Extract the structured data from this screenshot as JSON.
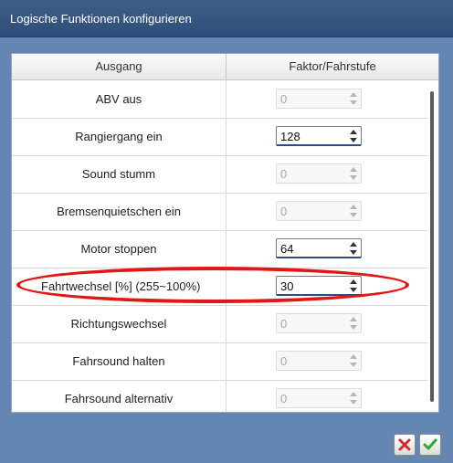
{
  "window": {
    "title": "Logische Funktionen konfigurieren"
  },
  "table": {
    "columns": [
      "Ausgang",
      "Faktor/Fahrstufe"
    ],
    "rows": [
      {
        "label": "ABV aus",
        "value": "0",
        "enabled": false
      },
      {
        "label": "Rangiergang ein",
        "value": "128",
        "enabled": true
      },
      {
        "label": "Sound stumm",
        "value": "0",
        "enabled": false
      },
      {
        "label": "Bremsenquietschen ein",
        "value": "0",
        "enabled": false
      },
      {
        "label": "Motor stoppen",
        "value": "64",
        "enabled": true
      },
      {
        "label": "Fahrtwechsel [%] (255~100%)",
        "value": "30",
        "enabled": true,
        "highlighted": true
      },
      {
        "label": "Richtungswechsel",
        "value": "0",
        "enabled": false
      },
      {
        "label": "Fahrsound halten",
        "value": "0",
        "enabled": false
      },
      {
        "label": "Fahrsound alternativ",
        "value": "0",
        "enabled": false
      }
    ]
  },
  "buttons": {
    "cancel_icon": "close-icon",
    "ok_icon": "check-icon"
  },
  "colors": {
    "title_bar": "#2e4d78",
    "highlight_ellipse": "#e01818",
    "cancel": "#d42a2a",
    "ok": "#2fa82f"
  }
}
